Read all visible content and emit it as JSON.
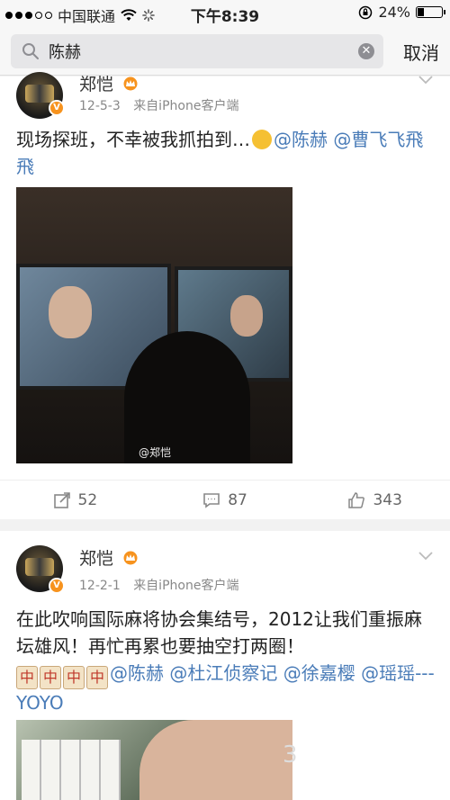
{
  "status_bar": {
    "carrier": "中国联通",
    "time": "下午8:39",
    "battery_text": "24%",
    "battery_level": 0.24
  },
  "search": {
    "query": "陈赫",
    "placeholder": "",
    "cancel_label": "取消"
  },
  "posts": [
    {
      "author": "郑恺",
      "date": "12-5-3",
      "source": "来自iPhone客户端",
      "text_plain": "现场探班，不幸被我抓拍到…",
      "mentions": [
        "@陈赫",
        "@曹飞飞飛飛"
      ],
      "image_watermark": "@郑恺",
      "repost_count": "52",
      "comment_count": "87",
      "like_count": "343"
    },
    {
      "author": "郑恺",
      "date": "12-2-1",
      "source": "来自iPhone客户端",
      "text_line1": "在此吹响国际麻将协会集结号，2012让我们重振麻坛雄风！再忙再累也要抽空打两圈！",
      "tiles": [
        "中",
        "中",
        "中",
        "中"
      ],
      "mentions": [
        "@陈赫",
        "@杜江侦察记",
        "@徐嘉樱",
        "@瑶瑶---YOYO"
      ],
      "image_counter": "3"
    }
  ],
  "colors": {
    "mention": "#4a7cb8",
    "vip_badge": "#f7931e",
    "background": "#f2f2f2"
  }
}
